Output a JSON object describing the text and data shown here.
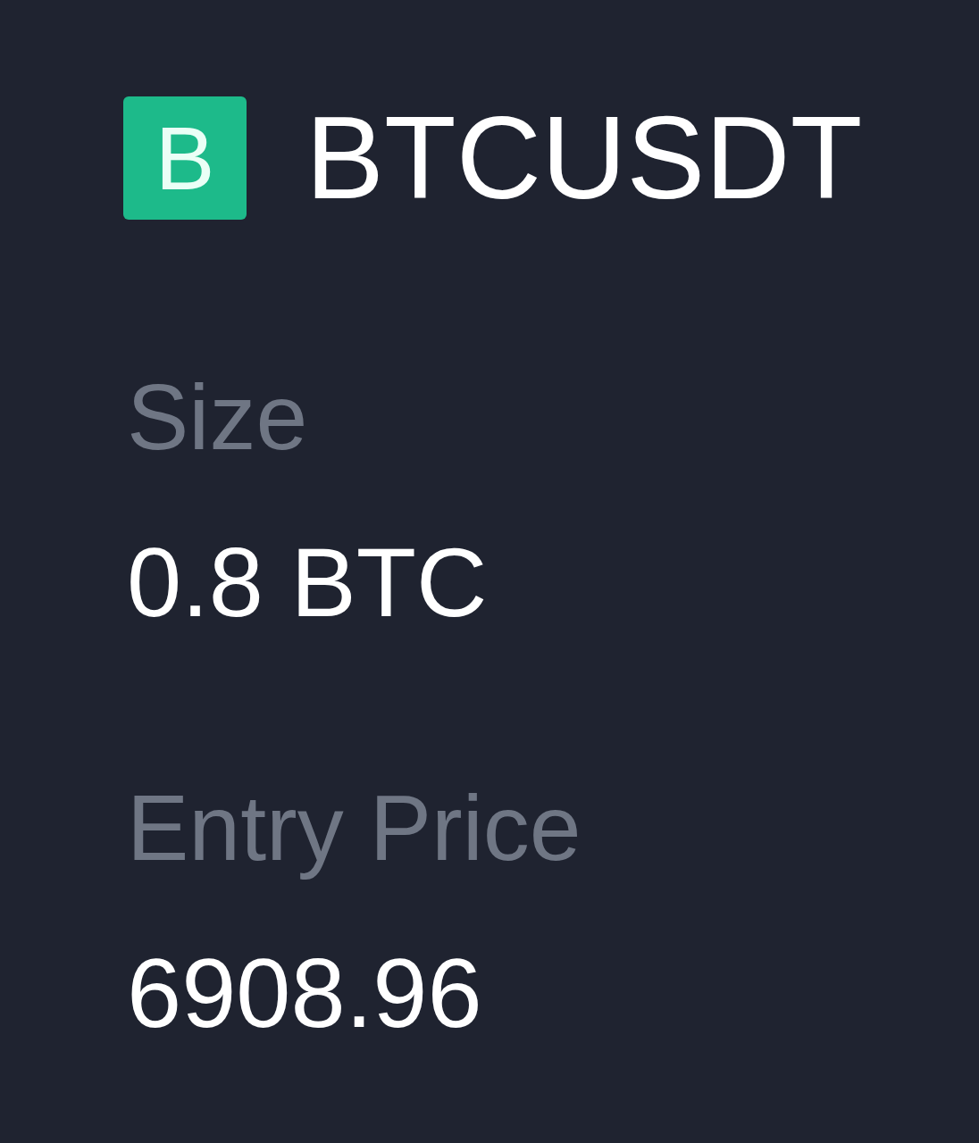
{
  "symbol": {
    "badge": "B",
    "name": "BTCUSDT"
  },
  "fields": [
    {
      "label": "Size",
      "value": "0.8 BTC"
    },
    {
      "label": "Entry Price",
      "value": "6908.96"
    }
  ]
}
